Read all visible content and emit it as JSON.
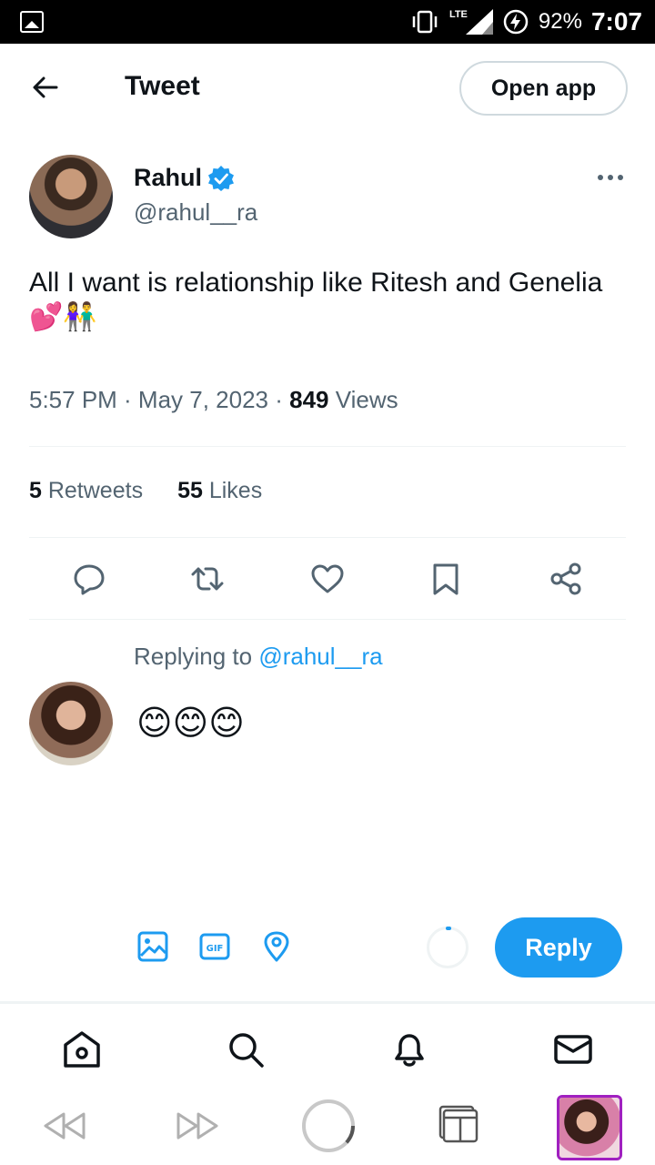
{
  "status_bar": {
    "network": "LTE",
    "battery_percent": "92%",
    "time": "7:07"
  },
  "header": {
    "title": "Tweet",
    "open_app_label": "Open app"
  },
  "tweet": {
    "author_name": "Rahul",
    "author_handle": "@rahul__ra",
    "text": "All I want is relationship like Ritesh and Genelia💕👫",
    "time": "5:57 PM · May 7, 2023 · ",
    "views_count": "849",
    "views_label": " Views",
    "retweets_count": "5",
    "retweets_label": " Retweets",
    "likes_count": "55",
    "likes_label": " Likes"
  },
  "reply": {
    "replying_prefix": "Replying to ",
    "replying_handle": "@rahul__ra",
    "text": "😊😊😊",
    "button_label": "Reply"
  },
  "colors": {
    "accent": "#1d9bf0",
    "text": "#0f1419",
    "muted": "#536471",
    "border": "#cfd9de"
  },
  "icons": {
    "compose_toolbar": [
      "image-icon",
      "gif-icon",
      "location-icon"
    ],
    "tweet_actions": [
      "reply-icon",
      "retweet-icon",
      "like-icon",
      "bookmark-icon",
      "share-icon"
    ],
    "bottom_nav": [
      "home-icon",
      "search-icon",
      "notifications-icon",
      "messages-icon"
    ],
    "system_nav": [
      "rewind-icon",
      "fast-forward-icon",
      "home-circle-icon",
      "tabs-icon"
    ]
  }
}
